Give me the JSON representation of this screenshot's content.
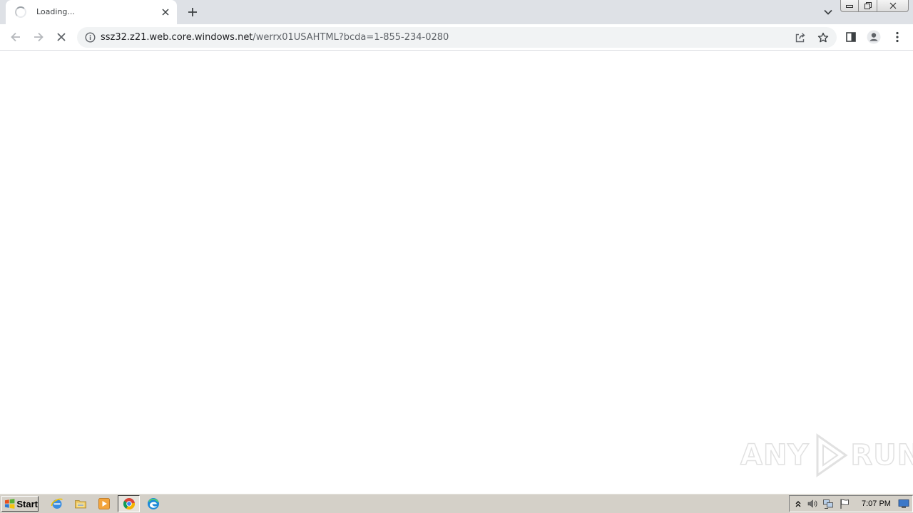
{
  "browser": {
    "tab": {
      "title": "Loading..."
    },
    "address_bar": {
      "url_host": "ssz32.z21.web.core.windows.net",
      "url_path": "/werrx01USAHTML?bcda=1-855-234-0280"
    },
    "icons": {
      "tab_loading": "loading-spinner-icon",
      "tab_close": "close-icon",
      "new_tab": "plus-icon",
      "tab_search": "chevron-down-icon",
      "back": "arrow-left-icon",
      "forward": "arrow-right-icon",
      "stop": "close-icon",
      "site_info": "info-icon",
      "share": "share-icon",
      "bookmark": "star-icon",
      "side_panel": "side-panel-icon",
      "profile": "person-icon",
      "menu": "kebab-menu-icon"
    }
  },
  "watermark": {
    "left_text": "ANY",
    "right_text": "RUN"
  },
  "taskbar": {
    "start_label": "Start",
    "clock": "7:07 PM"
  }
}
